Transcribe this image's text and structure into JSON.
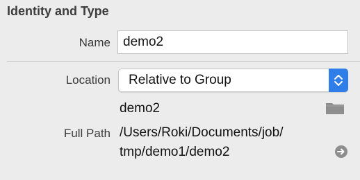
{
  "section": {
    "title": "Identity and Type"
  },
  "name": {
    "label": "Name",
    "value": "demo2"
  },
  "location": {
    "label": "Location",
    "selected": "Relative to Group",
    "resolved_name": "demo2"
  },
  "full_path": {
    "label": "Full Path",
    "line1": "/Users/Roki/Documents/job/",
    "line2": "tmp/demo1/demo2"
  },
  "icons": {
    "folder": "folder-icon",
    "reveal": "arrow-right-circle-icon",
    "popup": "updown-chevron-icon"
  },
  "colors": {
    "accent": "#2f7de8",
    "background": "#ececec"
  }
}
